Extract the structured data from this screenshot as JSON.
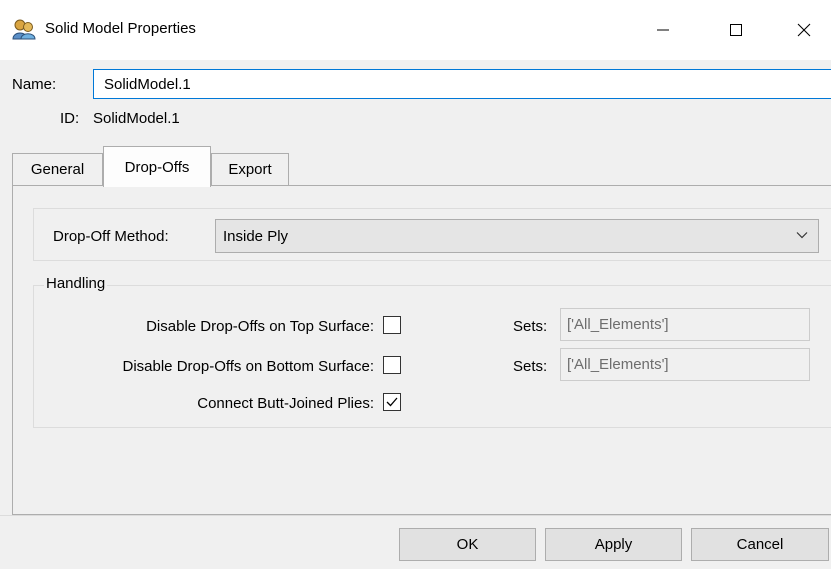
{
  "window": {
    "title": "Solid Model Properties",
    "icon": "users-icon",
    "controls": {
      "minimize": "minimize-icon",
      "maximize": "maximize-icon",
      "close": "close-icon"
    }
  },
  "form": {
    "name_label": "Name:",
    "name_value": "SolidModel.1",
    "id_label": "ID:",
    "id_value": "SolidModel.1"
  },
  "tabs": [
    {
      "label": "General",
      "selected": false
    },
    {
      "label": "Drop-Offs",
      "selected": true
    },
    {
      "label": "Export",
      "selected": false
    }
  ],
  "dropoffs": {
    "method_label": "Drop-Off Method:",
    "method_value": "Inside Ply",
    "handling": {
      "title": "Handling",
      "options": [
        {
          "label": "Disable Drop-Offs on Top Surface:",
          "checked": false,
          "sets_label": "Sets:",
          "sets_value": "['All_Elements']"
        },
        {
          "label": "Disable Drop-Offs on Bottom Surface:",
          "checked": false,
          "sets_label": "Sets:",
          "sets_value": "['All_Elements']"
        },
        {
          "label": "Connect Butt-Joined Plies:",
          "checked": true
        }
      ]
    }
  },
  "buttons": {
    "ok": "OK",
    "apply": "Apply",
    "cancel": "Cancel"
  }
}
